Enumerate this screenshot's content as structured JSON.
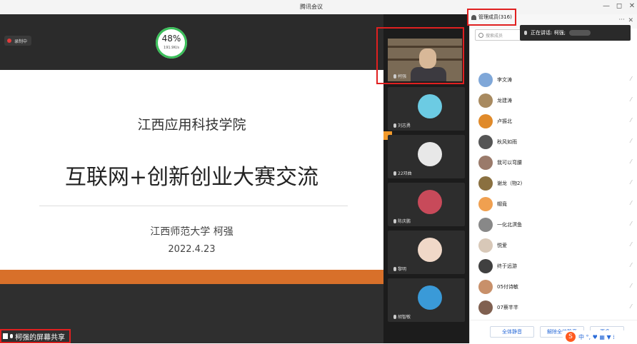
{
  "app": {
    "title": "腾讯会议",
    "minimize": "—",
    "restore": "◻",
    "close": "✕"
  },
  "stage": {
    "recording_label": "录制中",
    "network": {
      "percent": "48%",
      "speed": "191.9K/s"
    },
    "slide": {
      "school": "江西应用科技学院",
      "title": "互联网+创新创业大赛交流",
      "author": "江西师范大学  柯强",
      "date": "2022.4.23"
    },
    "share_label": "柯强的屏幕共享"
  },
  "videos": [
    {
      "name": "柯强",
      "avatar_color": "#7a6a55",
      "type": "camera"
    },
    {
      "name": "刘志勇",
      "avatar_color": "#6ccbe3",
      "type": "avatar"
    },
    {
      "name": "22邓曲",
      "avatar_color": "#e8e8e8",
      "type": "avatar"
    },
    {
      "name": "陈庆鹏",
      "avatar_color": "#c84a5a",
      "type": "avatar"
    },
    {
      "name": "黎明",
      "avatar_color": "#f0d8c8",
      "type": "avatar"
    },
    {
      "name": "胡智敏",
      "avatar_color": "#3a9ad8",
      "type": "avatar"
    }
  ],
  "panel": {
    "members_title": "管理成员(316)",
    "more": "···",
    "close": "✕",
    "search_placeholder": "搜索成员",
    "speaking_label": "正在讲话: 柯强;",
    "members": [
      {
        "name": "李文涛",
        "color": "#7fa7d8"
      },
      {
        "name": "龙建涛",
        "color": "#a88a60"
      },
      {
        "name": "卢振北",
        "color": "#e08a2a"
      },
      {
        "name": "秋风如雨",
        "color": "#555555"
      },
      {
        "name": "我可以弯腰",
        "color": "#9a7a6a"
      },
      {
        "name": "谢龙（物2)",
        "color": "#8a7040"
      },
      {
        "name": "帽竟",
        "color": "#f0a050"
      },
      {
        "name": "一化北溟鱼",
        "color": "#888888"
      },
      {
        "name": "悦爱",
        "color": "#d8c8b8"
      },
      {
        "name": "终于远游",
        "color": "#404040"
      },
      {
        "name": "05付诗敏",
        "color": "#c8906a"
      },
      {
        "name": "07蔡芊芊",
        "color": "#806050"
      }
    ],
    "buttons": {
      "mute_all": "全体静音",
      "unmute_all": "解除全体静音",
      "more": "更多 ▾"
    },
    "ime": {
      "logo": "S",
      "text": "中 °, ♥ ▦ ▼ ⁞"
    }
  }
}
